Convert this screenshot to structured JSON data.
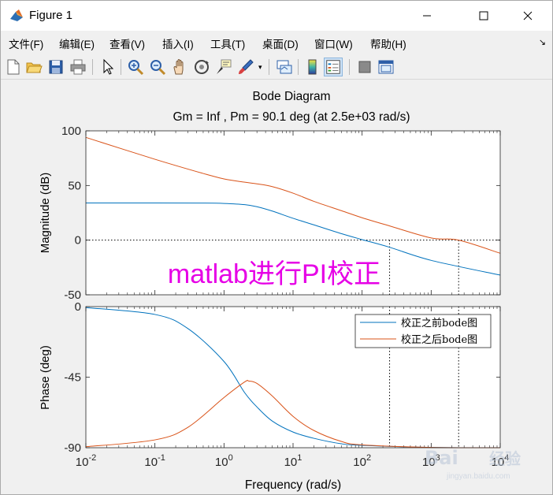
{
  "window": {
    "title": "Figure 1",
    "controls": [
      "minimize",
      "maximize",
      "close"
    ]
  },
  "menu": {
    "items": [
      "文件(F)",
      "编辑(E)",
      "查看(V)",
      "插入(I)",
      "工具(T)",
      "桌面(D)",
      "窗口(W)",
      "帮助(H)"
    ],
    "overflow_arrow": "↘"
  },
  "toolbar": {
    "buttons": [
      "new-figure-icon",
      "open-file-icon",
      "save-icon",
      "print-icon",
      "pointer-icon",
      "zoom-in-icon",
      "zoom-out-icon",
      "pan-hand-icon",
      "rotate-3d-icon",
      "data-cursor-icon",
      "brush-icon",
      "link-plot-icon",
      "colorbar-icon",
      "legend-icon",
      "hide-plot-tools-icon",
      "show-plot-tools-icon"
    ]
  },
  "plot": {
    "title_line1": "Bode Diagram",
    "title_line2": "Gm = Inf ,  Pm = 90.1 deg (at 2.5e+03 rad/s)",
    "annotation": "matlab进行PI校正",
    "annotation_color": "#e600e6",
    "magnitude_axis": {
      "ylabel": "Magnitude (dB)",
      "yticks": [
        "100",
        "50",
        "0",
        "-50"
      ]
    },
    "phase_axis": {
      "ylabel": "Phase (deg)",
      "yticks": [
        "0",
        "-45",
        "-90"
      ]
    },
    "xlabel": "Frequency  (rad/s)",
    "xticks": [
      {
        "base": "10",
        "exp": "-2"
      },
      {
        "base": "10",
        "exp": "-1"
      },
      {
        "base": "10",
        "exp": "0"
      },
      {
        "base": "10",
        "exp": "1"
      },
      {
        "base": "10",
        "exp": "2"
      },
      {
        "base": "10",
        "exp": "3"
      },
      {
        "base": "10",
        "exp": "4"
      }
    ],
    "legend": [
      {
        "label": "校正之前bode图",
        "color": "#0072bd"
      },
      {
        "label": "校正之后bode图",
        "color": "#d95319"
      }
    ],
    "watermark": {
      "text1": "Bai",
      "text2": "经验",
      "url": "jingyan.baidu.com"
    }
  },
  "chart_data": [
    {
      "type": "line",
      "title": "Bode Diagram",
      "ylabel": "Magnitude (dB)",
      "xlabel": "Frequency  (rad/s)",
      "xscale": "log",
      "xlim": [
        0.01,
        10000
      ],
      "ylim": [
        -50,
        100
      ],
      "grid": false,
      "series": [
        {
          "name": "校正之前bode图",
          "color": "#0072bd",
          "x": [
            0.01,
            0.1,
            0.5,
            1,
            2,
            3,
            5,
            10,
            20,
            50,
            100,
            250,
            1000,
            10000
          ],
          "y": [
            34,
            34,
            33.9,
            33.6,
            32.5,
            30.6,
            26.6,
            20,
            14,
            6,
            0.5,
            -6.5,
            -18.5,
            -32
          ]
        },
        {
          "name": "校正之后bode图",
          "color": "#d95319",
          "x": [
            0.01,
            0.1,
            0.5,
            1,
            2,
            3,
            5,
            10,
            20,
            50,
            100,
            250,
            1000,
            2500,
            10000
          ],
          "y": [
            94,
            74,
            61,
            56,
            53,
            51.5,
            49,
            43,
            35.5,
            27,
            20.5,
            13,
            2,
            0,
            -12
          ]
        }
      ],
      "reference_lines": {
        "y": 0,
        "x_markers": [
          250,
          2500
        ]
      }
    },
    {
      "type": "line",
      "ylabel": "Phase (deg)",
      "xlabel": "Frequency  (rad/s)",
      "xscale": "log",
      "xlim": [
        0.01,
        10000
      ],
      "ylim": [
        -90,
        0
      ],
      "grid": false,
      "legend_position": "top-right",
      "series": [
        {
          "name": "校正之前bode图",
          "color": "#0072bd",
          "x": [
            0.01,
            0.1,
            0.3,
            1,
            2,
            3,
            5,
            10,
            20,
            50,
            100,
            1000,
            10000
          ],
          "y": [
            -0.6,
            -5,
            -14,
            -35,
            -55,
            -64,
            -73,
            -80,
            -84,
            -87.5,
            -88.5,
            -89.8,
            -90
          ]
        },
        {
          "name": "校正之后bode图",
          "color": "#d95319",
          "x": [
            0.01,
            0.1,
            0.3,
            1,
            2,
            2.3,
            3,
            5,
            10,
            20,
            50,
            100,
            1000,
            10000
          ],
          "y": [
            -89.4,
            -85,
            -77,
            -58,
            -48,
            -47.5,
            -49,
            -57,
            -70,
            -79,
            -86,
            -88.2,
            -89.8,
            -90
          ]
        }
      ],
      "reference_lines": {
        "x_markers": [
          250,
          2500
        ]
      }
    }
  ]
}
